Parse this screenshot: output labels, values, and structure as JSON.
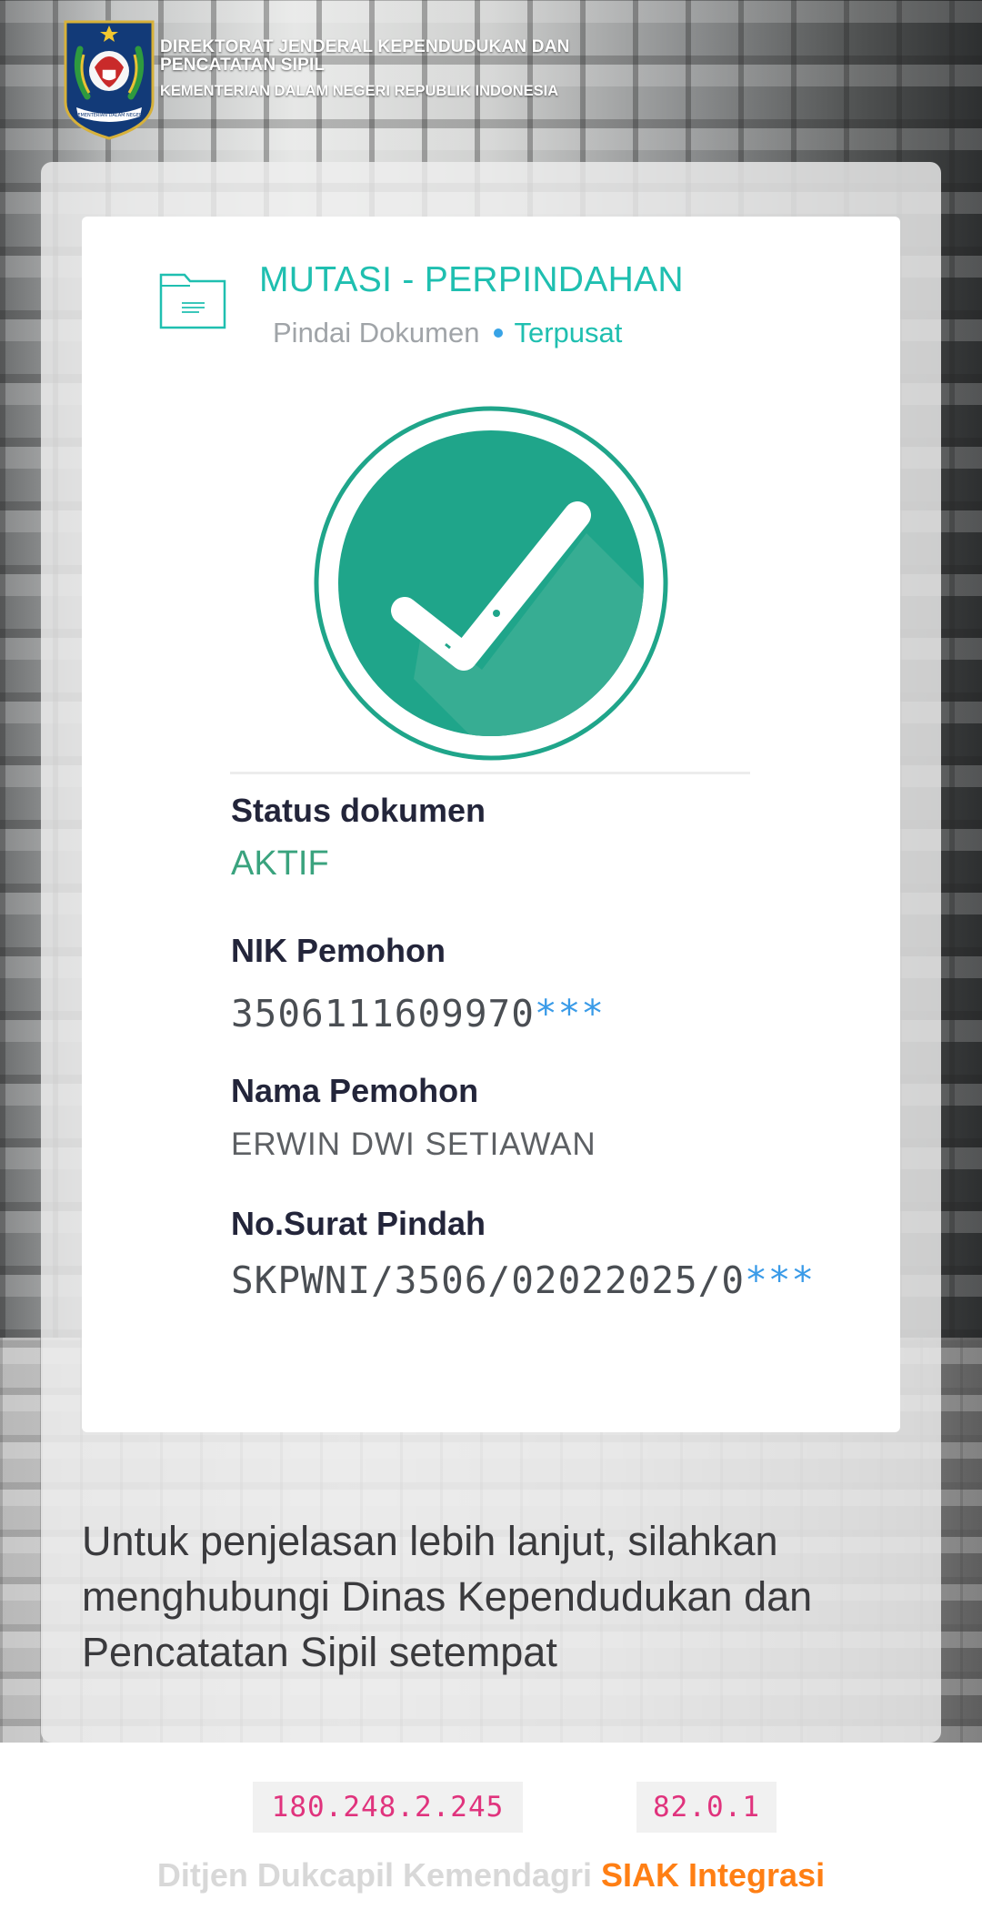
{
  "header": {
    "line1": "DIREKTORAT JENDERAL KEPENDUDUKAN DAN",
    "line2": "PENCATATAN SIPIL",
    "line3": "KEMENTERIAN DALAM NEGERI REPUBLIK INDONESIA",
    "logo_text": "KEMENTERIAN DALAM NEGERI"
  },
  "card": {
    "title": "MUTASI - PERPINDAHAN",
    "subtitle_left": "Pindai Dokumen",
    "subtitle_right": "Terpusat",
    "fields": {
      "status_label": "Status dokumen",
      "status_value": "AKTIF",
      "nik_label": "NIK Pemohon",
      "nik_value": "3506111609970",
      "nik_mask": "***",
      "name_label": "Nama Pemohon",
      "name_value": "ERWIN DWI SETIAWAN",
      "surat_label": "No.Surat Pindah",
      "surat_value": "SKPWNI/3506/02022025/0",
      "surat_mask": "***"
    }
  },
  "info_text": "Untuk penjelasan lebih lanjut, silahkan menghubungi Dinas Kependudukan dan Pencatatan Sipil setempat",
  "footer": {
    "ip_address": "180.248.2.245",
    "version": "82.0.1",
    "credit_left": "Ditjen Dukcapil Kemendagri",
    "credit_right": "SIAK Integrasi"
  },
  "colors": {
    "teal": "#1fbfb0",
    "check_green": "#1fa58a",
    "status_green": "#3aa37e",
    "mask_blue": "#3a9be8",
    "ip_pink": "#e0337d",
    "credit_orange": "#ff7f14"
  },
  "icons": [
    "garuda-logo-icon",
    "document-icon",
    "checkmark-badge-icon"
  ]
}
